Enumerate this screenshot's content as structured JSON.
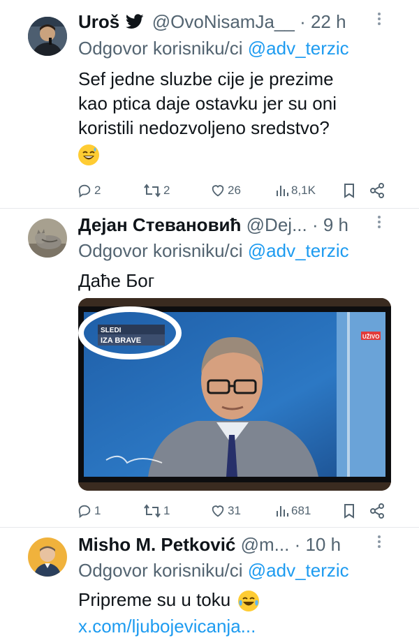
{
  "tweets": [
    {
      "name": "Uroš",
      "handle": "@OvoNisamJa__",
      "time": "· 22 h",
      "reply_prefix": "Odgovor korisniku/ci",
      "reply_mention": "@adv_terzic",
      "text_lines": [
        "Sef jedne sluzbe cije je prezime",
        "kao ptica daje ostavku jer su oni",
        "koristili nedozvoljeno sredstvo?"
      ],
      "emoji": "sweat-smile",
      "replies": "2",
      "retweets": "2",
      "likes": "26",
      "views": "8,1K"
    },
    {
      "name": "Дејан Стевановић",
      "handle": "@Dej...",
      "time": "· 9 h",
      "reply_prefix": "Odgovor korisniku/ci",
      "reply_mention": "@adv_terzic",
      "text": "Даће Бог",
      "image": {
        "tv_banner_line1": "SLEDI",
        "tv_banner_line2": "IZA BRAVE",
        "tv_live_badge": "UŽIVO"
      },
      "replies": "1",
      "retweets": "1",
      "likes": "31",
      "views": "681"
    },
    {
      "name": "Misho M. Petković",
      "handle": "@m...",
      "time": "· 10 h",
      "reply_prefix": "Odgovor korisniku/ci",
      "reply_mention": "@adv_terzic",
      "text": "Pripreme su u toku",
      "emoji": "tears-of-joy",
      "link": "x.com/ljubojevicanja..."
    }
  ],
  "colors": {
    "link": "#1d9bf0",
    "secondary": "#536471",
    "verified": "#1d9bf0"
  }
}
